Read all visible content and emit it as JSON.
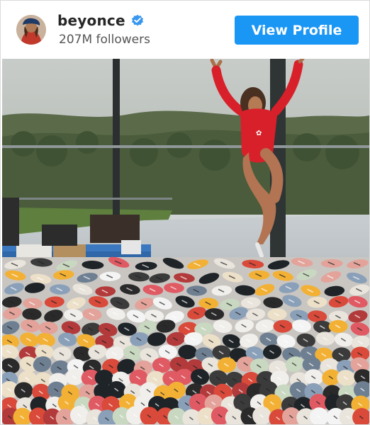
{
  "profile": {
    "username": "beyonce",
    "followers": "207M followers",
    "verified_icon": "verified-badge-icon",
    "avatar_icon": "profile-avatar"
  },
  "actions": {
    "view_profile_label": "View Profile"
  },
  "colors": {
    "button_blue": "#1a96f5",
    "verified_blue": "#3897f0",
    "suit_red": "#d8202a"
  },
  "post": {
    "image_description_icon": "post-photo"
  }
}
